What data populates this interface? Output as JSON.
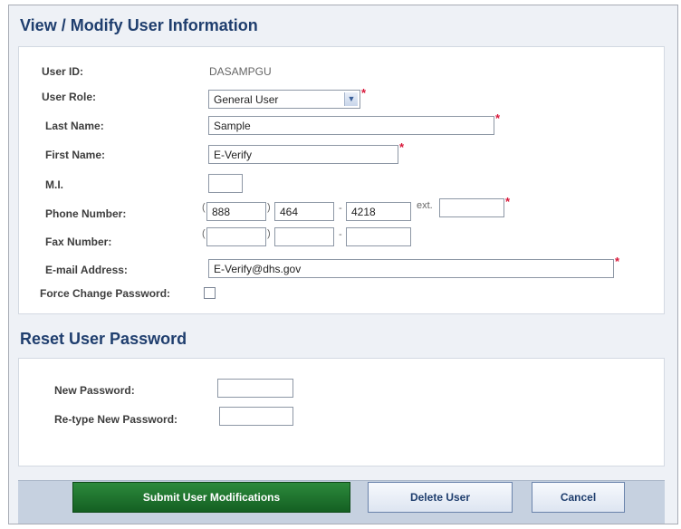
{
  "page": {
    "title": "View / Modify User Information",
    "reset_title": "Reset User Password"
  },
  "user_info": {
    "user_id_label": "User ID:",
    "user_id_value": "DASAMPGU",
    "role_label": "User Role:",
    "role_value": "General User",
    "last_name_label": "Last Name:",
    "last_name_value": "Sample",
    "first_name_label": "First Name:",
    "first_name_value": "E-Verify",
    "mi_label": "M.I.",
    "mi_value": "",
    "phone_label": "Phone Number:",
    "phone_area": "888",
    "phone_prefix": "464",
    "phone_line": "4218",
    "phone_ext_label": "ext.",
    "phone_ext": "",
    "fax_label": "Fax Number:",
    "fax_area": "",
    "fax_prefix": "",
    "fax_line": "",
    "email_label": "E-mail Address:",
    "email_value": "E-Verify@dhs.gov",
    "force_change_label": "Force Change Password:",
    "force_change_checked": false,
    "required_marker": "*",
    "open_paren": "(",
    "close_paren": ")",
    "dash": "-"
  },
  "reset_password": {
    "new_label": "New Password:",
    "new_value": "",
    "retype_label": "Re-type New Password:",
    "retype_value": ""
  },
  "actions": {
    "submit_label": "Submit User Modifications",
    "delete_label": "Delete User",
    "cancel_label": "Cancel"
  },
  "colors": {
    "title": "#1f3e6e",
    "required": "#d8183a",
    "primary_button": "#1e7a2e",
    "footer": "#c6d1e0"
  },
  "icons": {
    "dropdown": "chevron-down-icon",
    "checkbox": "checkbox-icon"
  }
}
